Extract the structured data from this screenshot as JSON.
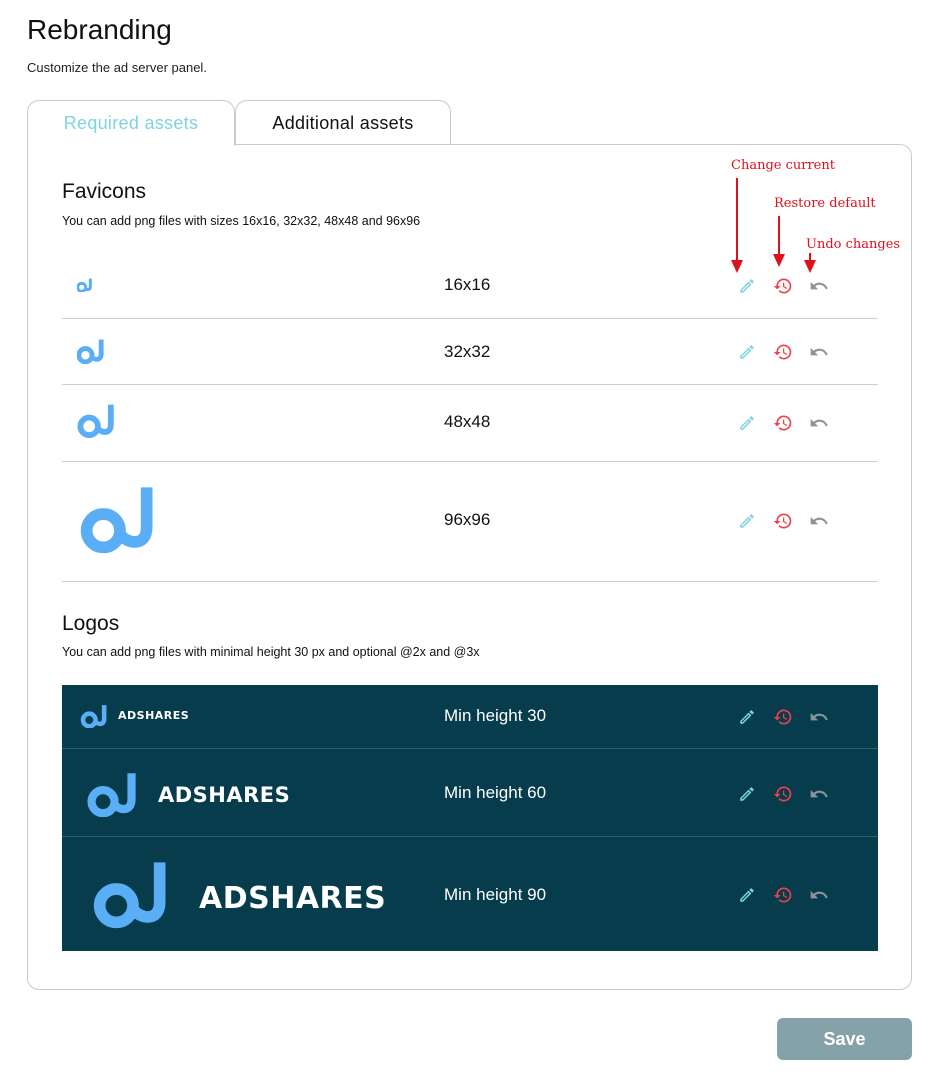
{
  "page": {
    "title": "Rebranding",
    "subtitle": "Customize the ad server panel."
  },
  "tabs": [
    {
      "label": "Required assets",
      "active": true
    },
    {
      "label": "Additional assets",
      "active": false
    }
  ],
  "favicons": {
    "title": "Favicons",
    "description": "You can add png files with sizes 16x16, 32x32, 48x48 and 96x96",
    "rows": [
      {
        "label": "16x16"
      },
      {
        "label": "32x32"
      },
      {
        "label": "48x48"
      },
      {
        "label": "96x96"
      }
    ]
  },
  "logos": {
    "title": "Logos",
    "description": "You can add png files with minimal height 30 px and optional @2x and @3x",
    "brand_text": "ADSHARES",
    "rows": [
      {
        "label": "Min height 30"
      },
      {
        "label": "Min height 60"
      },
      {
        "label": "Min height 90"
      }
    ]
  },
  "annotations": {
    "change_current": "Change current",
    "restore_default": "Restore default",
    "undo_changes": "Undo changes"
  },
  "icons": {
    "edit": "pencil-icon",
    "restore": "restore-history-icon",
    "undo": "undo-icon",
    "logo": "adshares-logo-icon"
  },
  "colors": {
    "accent": "#7fd3df",
    "logo_blue": "#5aaef5",
    "restore_red": "#f0414b",
    "undo_gray": "#8a959b",
    "logo_bg": "#063c4c",
    "save_button": "#86a2a9",
    "annotation_red": "#e0101a"
  },
  "save_button": {
    "label": "Save"
  }
}
